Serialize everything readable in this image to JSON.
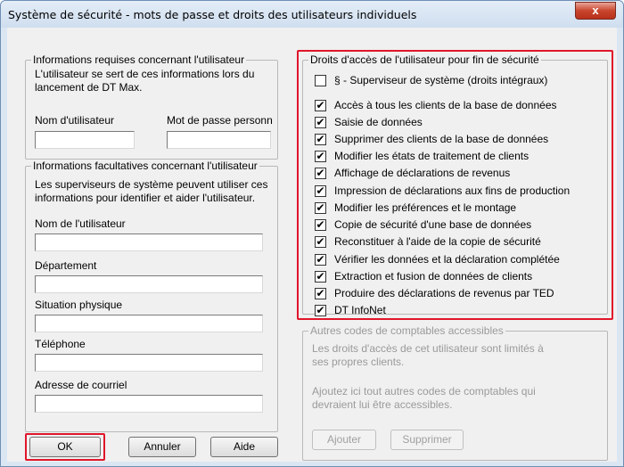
{
  "window": {
    "title": "Système de sécurité - mots de passe et droits des utilisateurs individuels",
    "close_label": "x"
  },
  "required_info": {
    "legend": "Informations requises concernant l'utilisateur",
    "description": "L'utilisateur se sert de ces informations lors du lancement de DT Max.",
    "username_label": "Nom d'utilisateur",
    "username_value": "",
    "password_label": "Mot de passe personn",
    "password_value": ""
  },
  "optional_info": {
    "legend": "Informations facultatives concernant l'utilisateur",
    "description": "Les superviseurs de système peuvent utiliser ces informations pour identifier et aider l'utilisateur.",
    "fields": [
      {
        "label": "Nom de l'utilisateur",
        "value": ""
      },
      {
        "label": "Département",
        "value": ""
      },
      {
        "label": "Situation physique",
        "value": ""
      },
      {
        "label": "Téléphone",
        "value": ""
      },
      {
        "label": "Adresse de courriel",
        "value": ""
      }
    ]
  },
  "access_rights": {
    "legend": "Droits d'accès de l'utilisateur pour fin de sécurité",
    "items": [
      {
        "label": "§ - Superviseur de système (droits intégraux)",
        "checked": false
      },
      {
        "label": "Accès à tous les clients de la base de données",
        "checked": true
      },
      {
        "label": "Saisie de données",
        "checked": true
      },
      {
        "label": "Supprimer des clients de la base de données",
        "checked": true
      },
      {
        "label": "Modifier les états de traitement de clients",
        "checked": true
      },
      {
        "label": "Affichage de déclarations de revenus",
        "checked": true
      },
      {
        "label": "Impression de déclarations aux fins de production",
        "checked": true
      },
      {
        "label": "Modifier les préférences et le montage",
        "checked": true
      },
      {
        "label": "Copie de sécurité d'une base de données",
        "checked": true
      },
      {
        "label": "Reconstituer à l'aide de la copie de sécurité",
        "checked": true
      },
      {
        "label": "Vérifier les données et la déclaration complétée",
        "checked": true
      },
      {
        "label": "Extraction et fusion de données de clients",
        "checked": true
      },
      {
        "label": "Produire des déclarations de revenus par TED",
        "checked": true
      },
      {
        "label": "DT InfoNet",
        "checked": true
      }
    ]
  },
  "other_codes": {
    "legend": "Autres codes de comptables accessibles",
    "text1": "Les droits d'accès de cet utilisateur sont limités à ses propres clients.",
    "text2": "Ajoutez ici tout autres codes de comptables qui devraient lui être accessibles.",
    "add_label": "Ajouter",
    "delete_label": "Supprimer"
  },
  "buttons": {
    "ok": "OK",
    "cancel": "Annuler",
    "help": "Aide"
  },
  "colors": {
    "highlight": "#e0162b",
    "close_button": "#c9452c"
  }
}
